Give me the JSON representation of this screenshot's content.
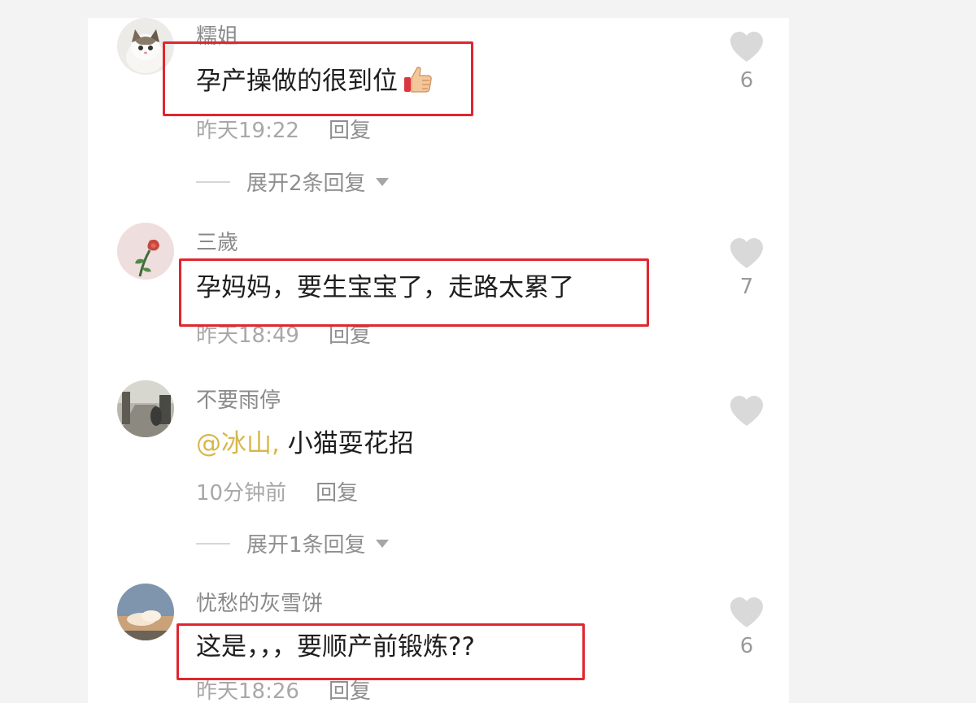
{
  "colors": {
    "highlight_box": "#e0262f",
    "mention": "#d8b74a",
    "username": "#8a8a8a",
    "heart": "#d9d9d9"
  },
  "comments": [
    {
      "username": "糯姐",
      "text": "孕产操做的很到位",
      "emoji": "thumbs-up-icon",
      "time": "昨天19:22",
      "reply_label": "回复",
      "likes": "6",
      "expand_label": "展开2条回复"
    },
    {
      "username": "三歲",
      "text": "孕妈妈，要生宝宝了，走路太累了",
      "time": "昨天18:49",
      "reply_label": "回复",
      "likes": "7"
    },
    {
      "username": "不要雨停",
      "mention": "@冰山,",
      "text": "小猫耍花招",
      "time": "10分钟前",
      "reply_label": "回复",
      "expand_label": "展开1条回复"
    },
    {
      "username": "忧愁的灰雪饼",
      "text": "这是，，，要顺产前锻炼??",
      "time": "昨天18:26",
      "reply_label": "回复",
      "likes": "6"
    }
  ]
}
